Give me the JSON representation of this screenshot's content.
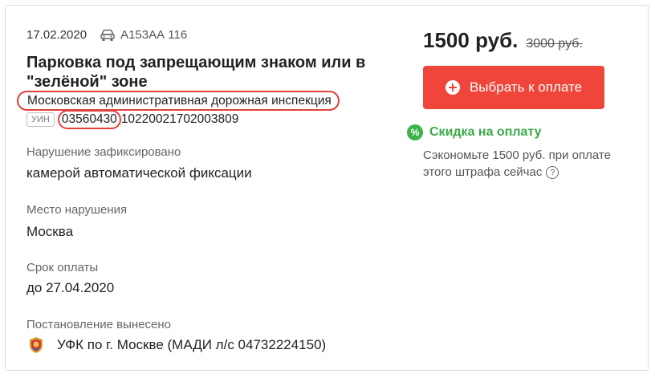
{
  "fine": {
    "date": "17.02.2020",
    "plate": "А153АА 116",
    "title": "Парковка под запрещающим знаком или в \"зелёной\" зоне",
    "authority": "Московская административная дорожная инспекция",
    "uin_badge": "УИН",
    "uin_part1": "03560430",
    "uin_part2": "10220021702003809",
    "recorded_label": "Нарушение зафиксировано",
    "recorded_value": "камерой автоматической фиксации",
    "place_label": "Место нарушения",
    "place_value": "Москва",
    "deadline_label": "Срок оплаты",
    "deadline_value": "до 27.04.2020",
    "issued_label": "Постановление вынесено",
    "issued_value": "УФК по г. Москве (МАДИ л/с 04732224150)"
  },
  "payment": {
    "price": "1500 руб.",
    "old_price": "3000 руб.",
    "button_label": "Выбрать к оплате",
    "discount_icon": "%",
    "discount_title": "Скидка на оплату",
    "discount_desc": "Сэкономьте 1500 руб. при оплате этого штрафа сейчас",
    "help_icon": "?"
  },
  "colors": {
    "accent_red": "#f0453a",
    "discount_green": "#3db34a",
    "highlight_outline": "#e0403a"
  },
  "icons": {
    "car": "car-icon",
    "plus": "plus-circle-icon",
    "percent": "percent-badge-icon",
    "help": "help-circle-icon",
    "emblem": "moscow-emblem-icon"
  }
}
